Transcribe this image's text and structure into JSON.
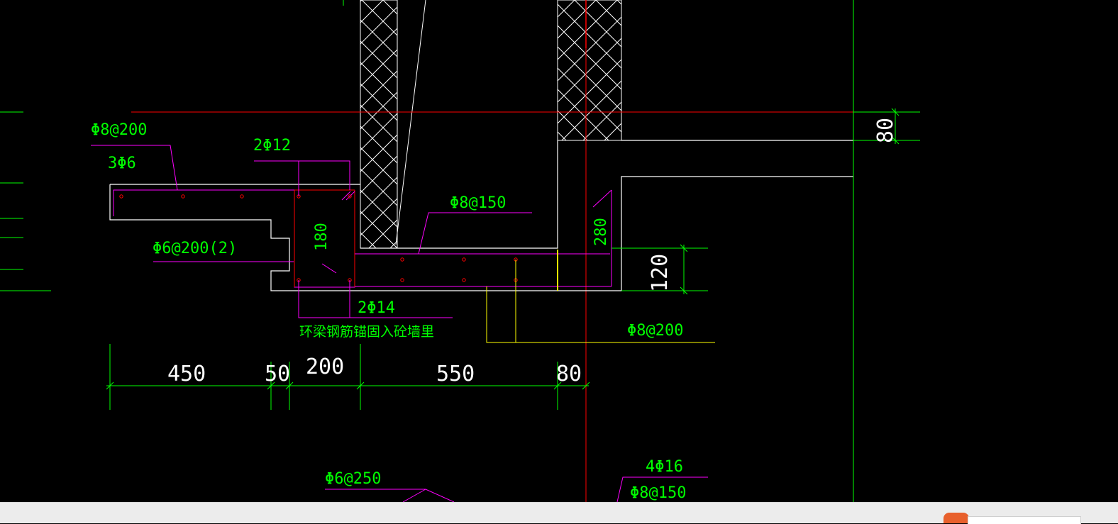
{
  "colors": {
    "background": "#000000",
    "wall": "#ffffff",
    "rebar_leader": "#ff00ff",
    "annotation": "#00ff00",
    "axis": "#ff0000",
    "rebar_outline": "#ff0000",
    "yellow_rebar": "#ffff00",
    "status_bar": "#ececec",
    "status_logo": "#e8602c"
  },
  "annotations": {
    "rebar_top_slab": "Φ8@200",
    "rebar_dist": "3Φ6",
    "beam_top_bars": "2Φ12",
    "beam_stirrup": "Φ6@200(2)",
    "beam_height": "180",
    "slab_bottom": "Φ8@150",
    "beam_bottom_bars": "2Φ14",
    "anchor_note": "环梁钢筋锚固入砼墙里",
    "wall_height": "280",
    "slab_thickness": "120",
    "top_thickness": "80",
    "wall_rebar": "Φ8@200",
    "lower_stirrup": "Φ6@250",
    "col_bars": "4Φ16",
    "col_stirrup": "Φ8@150"
  },
  "dimensions": {
    "d1": "450",
    "d2": "50",
    "d3": "200",
    "d4": "550",
    "d5": "80"
  }
}
